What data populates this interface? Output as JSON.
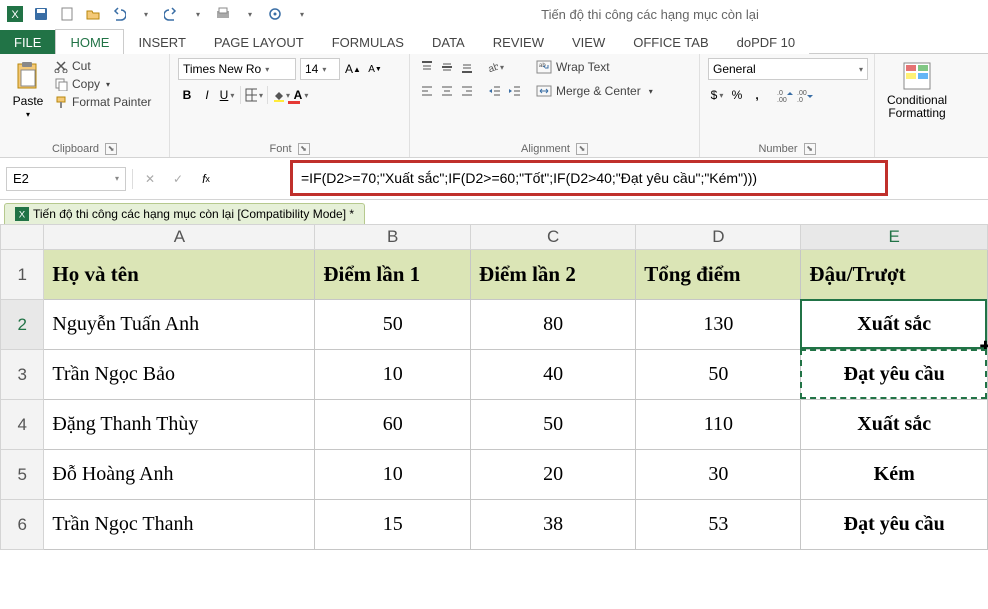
{
  "window_title": "Tiến độ thi công các hạng mục còn lại",
  "qat_icons": [
    "excel-icon",
    "save-icon",
    "new-icon",
    "open-icon",
    "undo-icon",
    "redo-icon",
    "print-preview-icon",
    "touch-mode-icon"
  ],
  "tabs": {
    "file": "FILE",
    "items": [
      "HOME",
      "INSERT",
      "PAGE LAYOUT",
      "FORMULAS",
      "DATA",
      "REVIEW",
      "VIEW",
      "OFFICE TAB",
      "doPDF 10"
    ],
    "active": "HOME"
  },
  "ribbon": {
    "clipboard": {
      "paste": "Paste",
      "cut": "Cut",
      "copy": "Copy",
      "format_painter": "Format Painter",
      "label": "Clipboard"
    },
    "font": {
      "name": "Times New Ro",
      "size": "14",
      "bold": "B",
      "italic": "I",
      "underline": "U",
      "label": "Font"
    },
    "alignment": {
      "wrap": "Wrap Text",
      "merge": "Merge & Center",
      "label": "Alignment"
    },
    "number": {
      "format": "General",
      "currency": "$",
      "percent": "%",
      "comma": ",",
      "label": "Number"
    },
    "styles": {
      "conditional": "Conditional\nFormatting",
      "label": ""
    }
  },
  "namebox": "E2",
  "formula": "=IF(D2>=70;\"Xuất sắc\";IF(D2>=60;\"Tốt\";IF(D2>40;\"Đạt yêu cầu\";\"Kém\")))",
  "workbook_tab": "Tiến độ thi công các hạng mục còn lại  [Compatibility Mode] *",
  "columns": [
    "A",
    "B",
    "C",
    "D",
    "E"
  ],
  "headers": {
    "A": "Họ và tên",
    "B": "Điểm lần 1",
    "C": "Điểm lần 2",
    "D": "Tổng điểm",
    "E": "Đậu/Trượt"
  },
  "rows": [
    {
      "n": "2",
      "A": "Nguyễn Tuấn Anh",
      "B": "50",
      "C": "80",
      "D": "130",
      "E": "Xuất sắc"
    },
    {
      "n": "3",
      "A": "Trần Ngọc Bảo",
      "B": "10",
      "C": "40",
      "D": "50",
      "E": "Đạt yêu cầu"
    },
    {
      "n": "4",
      "A": "Đặng Thanh Thùy",
      "B": "60",
      "C": "50",
      "D": "110",
      "E": "Xuất sắc"
    },
    {
      "n": "5",
      "A": "Đỗ Hoàng Anh",
      "B": "10",
      "C": "20",
      "D": "30",
      "E": "Kém"
    },
    {
      "n": "6",
      "A": "Trần Ngọc Thanh",
      "B": "15",
      "C": "38",
      "D": "53",
      "E": "Đạt yêu cầu"
    }
  ],
  "chart_data": {
    "type": "table",
    "title": "Đậu/Trượt",
    "columns": [
      "Họ và tên",
      "Điểm lần 1",
      "Điểm lần 2",
      "Tổng điểm",
      "Đậu/Trượt"
    ],
    "rows": [
      [
        "Nguyễn Tuấn Anh",
        50,
        80,
        130,
        "Xuất sắc"
      ],
      [
        "Trần Ngọc Bảo",
        10,
        40,
        50,
        "Đạt yêu cầu"
      ],
      [
        "Đặng Thanh Thùy",
        60,
        50,
        110,
        "Xuất sắc"
      ],
      [
        "Đỗ Hoàng Anh",
        10,
        20,
        30,
        "Kém"
      ],
      [
        "Trần Ngọc Thanh",
        15,
        38,
        53,
        "Đạt yêu cầu"
      ]
    ]
  }
}
